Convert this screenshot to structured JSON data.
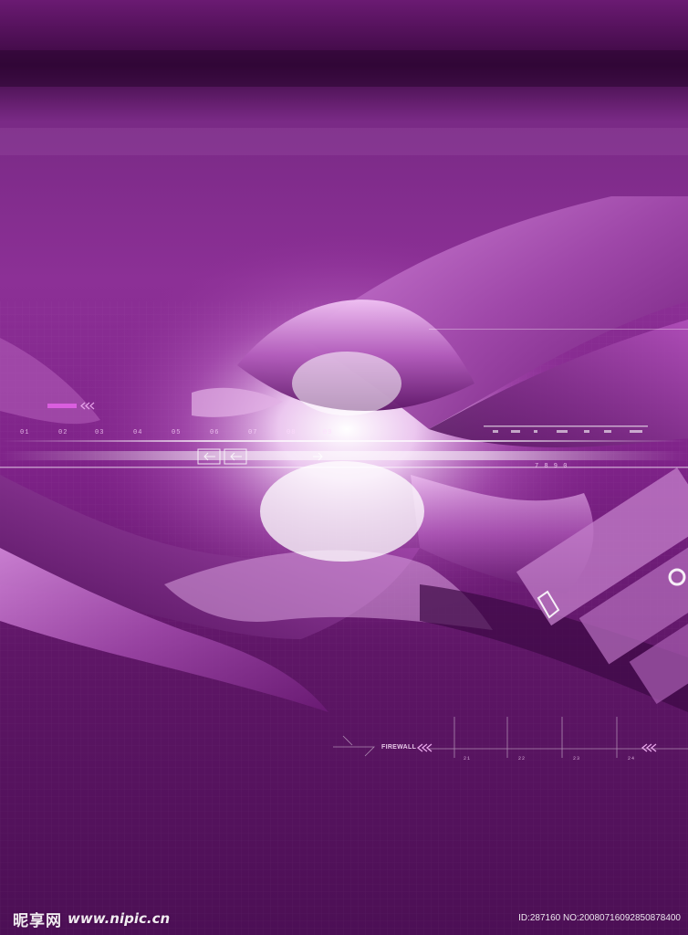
{
  "image": {
    "description_colors": {
      "base": "#4a0f52",
      "deep": "#2a0530",
      "mid": "#8a2a92",
      "bright": "#e9a8ef",
      "glow": "#ffffff"
    }
  },
  "hud": {
    "tick_numbers": [
      "01",
      "02",
      "03",
      "04",
      "05",
      "06",
      "07",
      "08",
      "09"
    ],
    "code_digits": "7 8 9 0",
    "firewall_label": "FIREWALL",
    "scale_numbers": [
      "21",
      "22",
      "23",
      "24"
    ]
  },
  "watermark": {
    "brand": "昵享网",
    "url": "www.nipic.cn",
    "id_text": "ID:287160 NO:20080716092850878400"
  }
}
